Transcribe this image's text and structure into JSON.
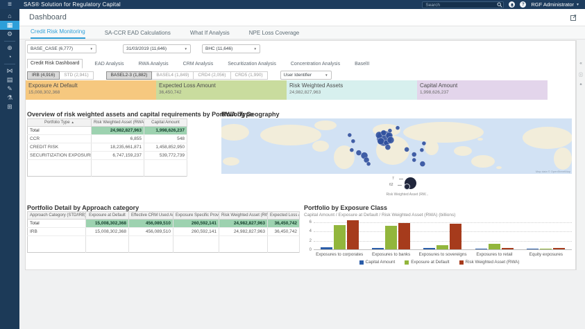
{
  "app": {
    "title": "SAS® Solution for Regulatory Capital",
    "search_placeholder": "Search",
    "user": "RGF Administrator",
    "page_title": "Dashboard"
  },
  "sidebar": {
    "items": [
      {
        "name": "home-icon",
        "glyph": "⌂",
        "active": false
      },
      {
        "name": "dashboard-icon",
        "glyph": "▦",
        "active": true
      },
      {
        "name": "settings-icon",
        "glyph": "⚙",
        "active": false
      },
      {
        "divider": true
      },
      {
        "name": "web-icon",
        "glyph": "⊕",
        "active": false
      },
      {
        "name": "reports-icon",
        "glyph": "◔",
        "active": false
      },
      {
        "divider": true
      },
      {
        "name": "workflow-icon",
        "glyph": "⋈",
        "active": false
      },
      {
        "name": "projects-icon",
        "glyph": "▤",
        "active": false
      },
      {
        "name": "edit-icon",
        "glyph": "✎",
        "active": false
      },
      {
        "name": "lab-icon",
        "glyph": "⚗",
        "active": false
      },
      {
        "name": "hierarchy-icon",
        "glyph": "⊞",
        "active": false
      }
    ]
  },
  "tabs_primary": {
    "active": 0,
    "items": [
      "Credit Risk Monitoring",
      "SA-CCR EAD Calculations",
      "What If Analysis",
      "NPE Loss Coverage"
    ]
  },
  "filters": [
    "BASE_CASE (6,777)",
    "31/03/2019 (11,646)",
    "BHC (11,646)"
  ],
  "tabs_secondary": {
    "active": 0,
    "items": [
      "Credit Risk Dashboard",
      "EAD Analysis",
      "RWA Analysis",
      "CRM Analysis",
      "Securitization Analysis",
      "Concentration Analysis",
      "BaselII"
    ]
  },
  "toggles": {
    "approach": [
      {
        "label": "IRB (4,916)",
        "selected": true
      },
      {
        "label": "STD (2,941)",
        "selected": false
      }
    ],
    "framework": [
      {
        "label": "BASEL2-3 (1,882)",
        "selected": true
      },
      {
        "label": "BASEL4 (1,849)",
        "selected": false
      },
      {
        "label": "CRD4 (2,056)",
        "selected": false
      },
      {
        "label": "CRD5 (1,990)",
        "selected": false
      }
    ],
    "user_identifier": "User Identifier"
  },
  "kpis": [
    {
      "label": "Exposure At Default",
      "value": "15,008,302,368",
      "color": "#f6c87f"
    },
    {
      "label": "Expected Loss Amount",
      "value": "36,450,742",
      "color": "#c9dc9e"
    },
    {
      "label": "Risk Weighted Assets",
      "value": "24,982,827,963",
      "color": "#d7f0ee"
    },
    {
      "label": "Capital Amount",
      "value": "1,998,626,237",
      "color": "#e3d5eb"
    }
  ],
  "portfolio_table": {
    "title": "Overview of risk weighted assets and capital requirements by Portfolio Type",
    "columns": [
      "Portfolio Type",
      "Risk Weighted Asset (RWA)",
      "Capital Amount"
    ],
    "rows": [
      [
        "Total",
        "24,982,827,963",
        "1,998,626,237"
      ],
      [
        "CCR",
        "6,855",
        "548"
      ],
      [
        "CREDIT RISK",
        "18,235,661,871",
        "1,458,852,950"
      ],
      [
        "SECURITIZATION EXPOSURES",
        "6,747,159,237",
        "539,772,739"
      ]
    ]
  },
  "geography": {
    "title": "RWA by Geography",
    "attribution": "Map data © OpenStreetMap",
    "size_legend": {
      "max": "7",
      "min": "62",
      "label": "Risk Weighted Asset (RW..."
    },
    "bubble_color": "#30509d",
    "bubbles": [
      {
        "x": 36.6,
        "y": 30,
        "r": 3
      },
      {
        "x": 37.6,
        "y": 41,
        "r": 3
      },
      {
        "x": 37.2,
        "y": 57,
        "r": 3
      },
      {
        "x": 39.2,
        "y": 62,
        "r": 4
      },
      {
        "x": 40.8,
        "y": 67,
        "r": 5
      },
      {
        "x": 41.4,
        "y": 75,
        "r": 4
      },
      {
        "x": 42.0,
        "y": 82,
        "r": 3
      },
      {
        "x": 46.5,
        "y": 36,
        "r": 11
      },
      {
        "x": 45.0,
        "y": 30,
        "r": 5
      },
      {
        "x": 46.3,
        "y": 26,
        "r": 4
      },
      {
        "x": 47.9,
        "y": 31,
        "r": 5
      },
      {
        "x": 45.5,
        "y": 41,
        "r": 5
      },
      {
        "x": 47.1,
        "y": 44,
        "r": 4
      },
      {
        "x": 48.3,
        "y": 39,
        "r": 5
      },
      {
        "x": 48.1,
        "y": 22,
        "r": 3
      },
      {
        "x": 50.3,
        "y": 17,
        "r": 3
      },
      {
        "x": 47.5,
        "y": 52,
        "r": 4
      },
      {
        "x": 52.9,
        "y": 56,
        "r": 3.5
      },
      {
        "x": 55.0,
        "y": 65,
        "r": 3.5
      },
      {
        "x": 57.2,
        "y": 57,
        "r": 3
      },
      {
        "x": 57.8,
        "y": 45,
        "r": 3
      },
      {
        "x": 55.0,
        "y": 75,
        "r": 3
      },
      {
        "x": 57.4,
        "y": 82,
        "r": 4
      }
    ]
  },
  "approach_table": {
    "title": "Portfolio Detail by Approach category",
    "columns": [
      "Approach Category (STD/IRB)",
      "Exposure at Default",
      "Effective CRM Used Amount",
      "Exposure Specific Provisions",
      "Risk Weighted Asset (RWA)",
      "Expected Loss Amount"
    ],
    "rows": [
      [
        "Total",
        "15,008,302,368",
        "456,089,510",
        "260,592,141",
        "24,982,827,963",
        "36,450,742"
      ],
      [
        "IRB",
        "15,008,302,368",
        "456,089,510",
        "260,592,141",
        "24,982,827,963",
        "36,450,742"
      ]
    ]
  },
  "chart_data": {
    "type": "bar",
    "title": "Portfolio by Exposure Class",
    "subtitle": "Capital Amount / Exposure at Default / Risk Weighted Asset (RWA) (billions)",
    "categories": [
      "Exposures to corporates",
      "Exposures to banks",
      "Exposures to sovereigns",
      "Exposures to retail",
      "Equity exposures"
    ],
    "series": [
      {
        "name": "Capital Amount",
        "color": "#2b5da8",
        "values": [
          0.4,
          0.3,
          0.25,
          0.05,
          0.02
        ]
      },
      {
        "name": "Exposure at Default",
        "color": "#92b63c",
        "values": [
          5.2,
          5.1,
          0.85,
          1.2,
          0.05
        ]
      },
      {
        "name": "Risk Weighted Asset (RWA)",
        "color": "#a63b1c",
        "values": [
          6.3,
          5.7,
          5.6,
          0.35,
          0.25
        ]
      }
    ],
    "yticks": [
      0,
      2,
      4,
      6
    ],
    "ylim": [
      0,
      6.9
    ],
    "xlabel": "",
    "ylabel": "",
    "grid": true,
    "legend_position": "bottom"
  },
  "right_toolbar": {
    "icons": [
      {
        "name": "collapse-panel-icon",
        "glyph": "«"
      },
      {
        "name": "info-icon",
        "glyph": "ⓘ"
      },
      {
        "name": "comments-icon",
        "glyph": "❝"
      }
    ]
  }
}
